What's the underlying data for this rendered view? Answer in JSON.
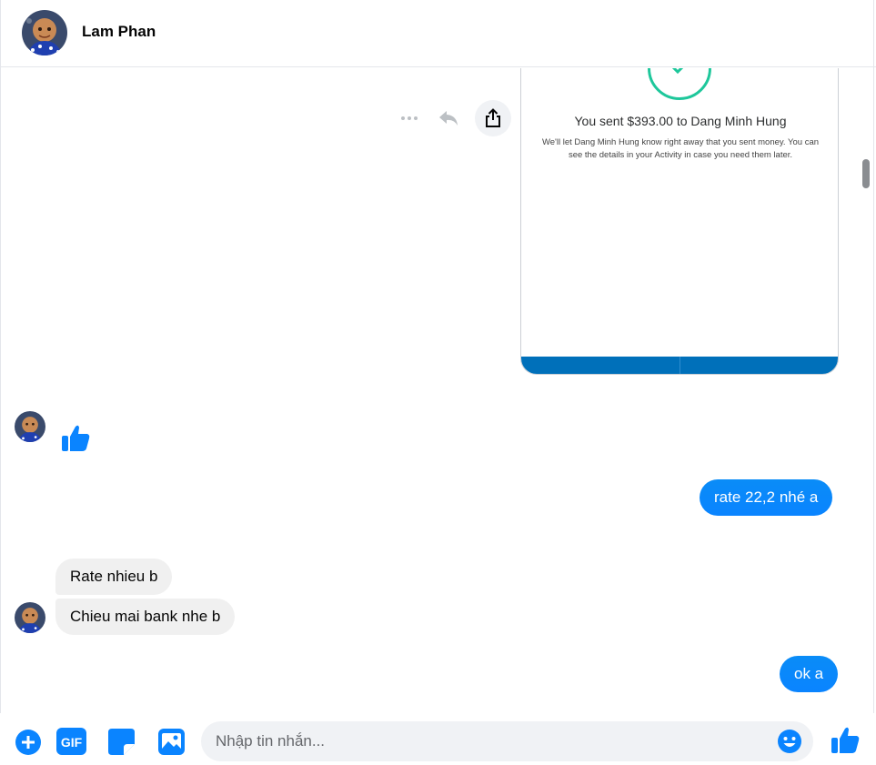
{
  "header": {
    "contact_name": "Lam Phan"
  },
  "receipt": {
    "title": "You sent $393.00 to Dang Minh Hung",
    "description": "We'll let Dang Minh Hung know right away that you sent money. You can see the details in your Activity in case you need them later.",
    "accent_color": "#1ec79b",
    "footer_color": "#0070ba"
  },
  "message_actions": {
    "more_icon": "more-horizontal-icon",
    "reply_icon": "reply-icon",
    "share_icon": "share-icon"
  },
  "messages": [
    {
      "from": "contact",
      "type": "like",
      "icon": "thumbs-up-icon"
    },
    {
      "from": "me",
      "text": "rate 22,2 nhé a"
    },
    {
      "from": "contact",
      "text": "Rate nhieu b"
    },
    {
      "from": "contact",
      "text": "Chieu mai bank nhe b"
    },
    {
      "from": "me",
      "text": "ok a"
    }
  ],
  "composer": {
    "placeholder": "Nhập tin nhắn...",
    "value": "",
    "icons": [
      "plus-circle-icon",
      "gif-icon",
      "sticker-icon",
      "image-icon",
      "emoji-icon",
      "thumbs-up-icon"
    ],
    "gif_label": "GIF"
  },
  "colors": {
    "brand": "#0084ff",
    "incoming_bubble": "#f0f0f0"
  }
}
